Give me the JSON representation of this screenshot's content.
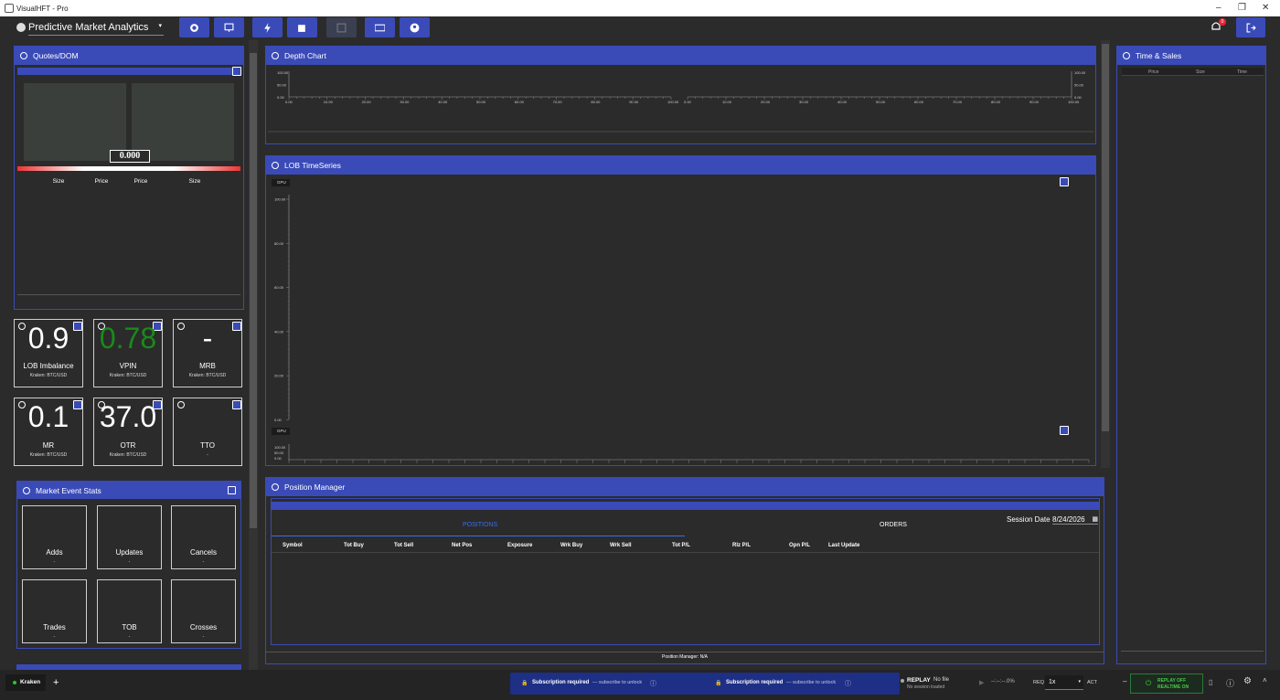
{
  "window": {
    "title": "VisualHFT - Pro",
    "minimize": "–",
    "restore": "❐",
    "close": "✕"
  },
  "toolbar": {
    "workspace": "Predictive Market Analytics",
    "notifications": "0"
  },
  "quotes": {
    "title": "Quotes/DOM",
    "mid": "0.000",
    "cols": [
      "Size",
      "Price",
      "Price",
      "Size"
    ]
  },
  "studies": [
    {
      "value": "0.9",
      "label": "LOB Imbalance",
      "sub": "Kraken: BTC/USD",
      "color": "#ffffff"
    },
    {
      "value": "0.78",
      "label": "VPIN",
      "sub": "Kraken: BTC/USD",
      "color": "#1a8a1a"
    },
    {
      "value": "-",
      "label": "MRB",
      "sub": "Kraken: BTC/USD",
      "color": "#ffffff"
    },
    {
      "value": "0.1",
      "label": "MR",
      "sub": "Kraken: BTC/USD",
      "color": "#ffffff"
    },
    {
      "value": "37.0",
      "label": "OTR",
      "sub": "Kraken: BTC/USD",
      "color": "#ffffff"
    },
    {
      "value": "",
      "label": "TTO",
      "sub": "-",
      "color": "#ffffff"
    }
  ],
  "mes": {
    "title": "Market Event Stats",
    "items": [
      {
        "label": "Adds",
        "sub": "-"
      },
      {
        "label": "Updates",
        "sub": "-"
      },
      {
        "label": "Cancels",
        "sub": "-"
      },
      {
        "label": "Trades",
        "sub": "-"
      },
      {
        "label": "TOB",
        "sub": "-"
      },
      {
        "label": "Crosses",
        "sub": "-"
      }
    ]
  },
  "depth": {
    "title": "Depth Chart",
    "y": [
      "100.00",
      "50.00",
      "0.00"
    ],
    "x": [
      "0.00",
      "10.00",
      "20.00",
      "30.00",
      "40.00",
      "50.00",
      "60.00",
      "70.00",
      "80.00",
      "90.00",
      "100.00"
    ]
  },
  "lob": {
    "title": "LOB TimeSeries",
    "gpu": "GPU",
    "y": [
      "100.00",
      "80.00",
      "60.00",
      "40.00",
      "20.00",
      "0.00"
    ],
    "y2": [
      "100.00",
      "50.00",
      "0.00"
    ]
  },
  "pm": {
    "title": "Position Manager",
    "tabs": [
      "POSITIONS",
      "ORDERS"
    ],
    "session_label": "Session Date",
    "session_date": "8/24/2026",
    "cols": [
      "Symbol",
      "Tot Buy",
      "Tot Sell",
      "Net Pos",
      "Exposure",
      "Wrk Buy",
      "Wrk Sell",
      "Tot P/L",
      "Rlz P/L",
      "Opn P/L",
      "Last Update"
    ],
    "footer": "Position Manager: N/A"
  },
  "ts": {
    "title": "Time & Sales",
    "cols": [
      "Price",
      "Size",
      "Time"
    ]
  },
  "status": {
    "tab": "Kraken",
    "add": "+",
    "sub1": "Subscription required",
    "sub1b": "— subscribe to unlock",
    "sub2": "Subscription required",
    "sub2b": "— subscribe to unlock",
    "replay": "REPLAY",
    "nofile": "No file",
    "nosession": "No session loaded",
    "time": "--:--:--.0%",
    "req": "REQ",
    "speed": "1x",
    "act": "ACT",
    "minus": "–",
    "replay_off": "REPLAY OFF",
    "realtime_on": "REALTIME ON"
  },
  "colors": {
    "accent": "#3a4bb8",
    "bg": "#2b2b2b",
    "green": "#1a8a1a"
  }
}
